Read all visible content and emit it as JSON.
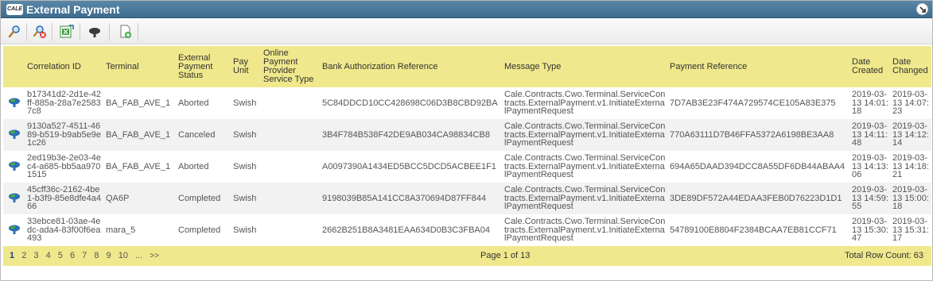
{
  "window": {
    "logo_text": "CALE",
    "title": "External Payment",
    "colors": {
      "title_bar": "#46789a",
      "header_bg": "#f0e88c",
      "row_alt": "#f2f2f2"
    }
  },
  "toolbar": {
    "buttons": [
      {
        "icon": "search-icon"
      },
      {
        "icon": "clear-search-icon"
      },
      {
        "icon": "export-excel-icon"
      },
      {
        "icon": "cloud-upload-icon"
      },
      {
        "icon": "add-document-icon"
      }
    ]
  },
  "table": {
    "headers": {
      "correlation_id": "Correlation ID",
      "terminal": "Terminal",
      "status": "External Payment Status",
      "pay_unit": "Pay Unit",
      "service_type": "Online Payment Provider Service Type",
      "bank_ref": "Bank Authorization Reference",
      "message_type": "Message Type",
      "payment_ref": "Payment Reference",
      "date_created": "Date Created",
      "date_changed": "Date Changed"
    },
    "rows": [
      {
        "correlation_id": "b17341d2-2d1e-42ff-885a-28a7e25837c8",
        "terminal": "BA_FAB_AVE_1",
        "status": "Aborted",
        "pay_unit": "Swish",
        "service_type": "",
        "bank_ref": "5C84DDCD10CC428698C06D3B8CBD92BA",
        "message_type": "Cale.Contracts.Cwo.Terminal.ServiceContracts.ExternalPayment.v1.InitiateExternalPaymentRequest",
        "payment_ref": "7D7AB3E23F474A729574CE105A83E375",
        "date_created": "2019-03-13 14:01:18",
        "date_changed": "2019-03-13 14:07:23"
      },
      {
        "correlation_id": "9130a527-4511-4689-b519-b9ab5e9e1c26",
        "terminal": "BA_FAB_AVE_1",
        "status": "Canceled",
        "pay_unit": "Swish",
        "service_type": "",
        "bank_ref": "3B4F784B538F42DE9AB034CA98834CB8",
        "message_type": "Cale.Contracts.Cwo.Terminal.ServiceContracts.ExternalPayment.v1.InitiateExternalPaymentRequest",
        "payment_ref": "770A63111D7B46FFA5372A6198BE3AA8",
        "date_created": "2019-03-13 14:11:48",
        "date_changed": "2019-03-13 14:12:14"
      },
      {
        "correlation_id": "2ed19b3e-2e03-4ec4-a685-bb5aa9701515",
        "terminal": "BA_FAB_AVE_1",
        "status": "Aborted",
        "pay_unit": "Swish",
        "service_type": "",
        "bank_ref": "A0097390A1434ED5BCC5DCD5ACBEE1F1",
        "message_type": "Cale.Contracts.Cwo.Terminal.ServiceContracts.ExternalPayment.v1.InitiateExternalPaymentRequest",
        "payment_ref": "694A65DAAD394DCC8A55DF6DB44ABAA4",
        "date_created": "2019-03-13 14:13:06",
        "date_changed": "2019-03-13 14:18:21"
      },
      {
        "correlation_id": "45cff36c-2162-4be1-b3f9-85e8dfe4a466",
        "terminal": "QA6P",
        "status": "Completed",
        "pay_unit": "Swish",
        "service_type": "",
        "bank_ref": "9198039B85A141CC8A370694D87FF844",
        "message_type": "Cale.Contracts.Cwo.Terminal.ServiceContracts.ExternalPayment.v1.InitiateExternalPaymentRequest",
        "payment_ref": "3DE89DF572A44EDAA3FEB0D76223D1D1",
        "date_created": "2019-03-13 14:59:55",
        "date_changed": "2019-03-13 15:00:18"
      },
      {
        "correlation_id": "33ebce81-03ae-4edc-ada4-83f00f6ea493",
        "terminal": "mara_5",
        "status": "Completed",
        "pay_unit": "Swish",
        "service_type": "",
        "bank_ref": "2662B251B8A3481EAA634D0B3C3FBA04",
        "message_type": "Cale.Contracts.Cwo.Terminal.ServiceContracts.ExternalPayment.v1.InitiateExternalPaymentRequest",
        "payment_ref": "54789100E8804F2384BCAA7EB81CCF71",
        "date_created": "2019-03-13 15:30:47",
        "date_changed": "2019-03-13 15:31:17"
      }
    ]
  },
  "footer": {
    "pages": [
      "1",
      "2",
      "3",
      "4",
      "5",
      "6",
      "7",
      "8",
      "9",
      "10",
      "..."
    ],
    "next": ">>",
    "current_page": "1",
    "page_info": "Page 1 of 13",
    "row_count": "Total Row Count: 63"
  }
}
